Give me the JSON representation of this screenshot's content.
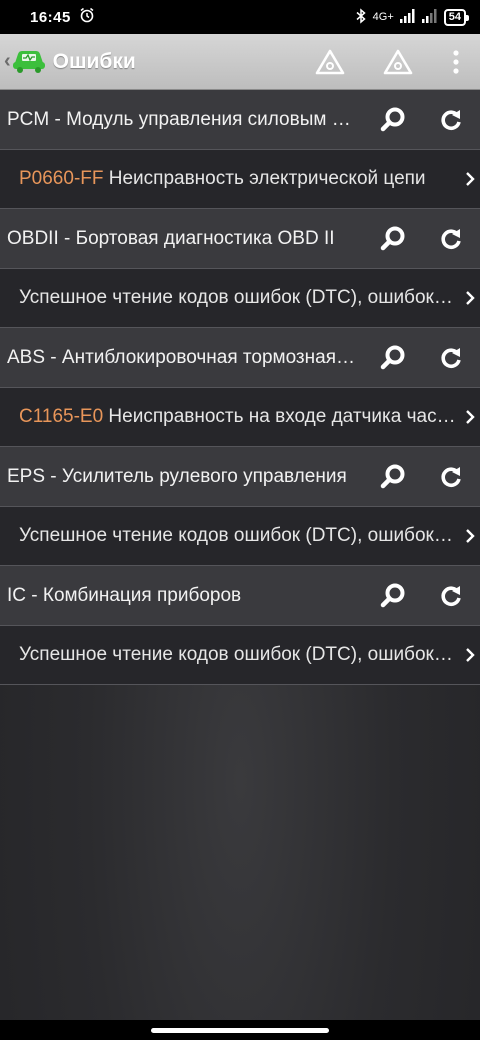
{
  "status_bar": {
    "time": "16:45",
    "network": "4G+",
    "battery": "54",
    "icons": [
      "alarm-icon",
      "bluetooth-icon",
      "signal-icon",
      "wifi-icon",
      "battery-icon"
    ]
  },
  "app_bar": {
    "title": "Ошибки",
    "actions": [
      "warning-triangle-icon",
      "warning-triangle-icon",
      "overflow-menu-icon"
    ]
  },
  "colors": {
    "dtc_code": "#e8965a",
    "module_row_bg": "#3a3a3e",
    "detail_row_bg": "#26262a",
    "app_bar_bg": "#c9c9c9",
    "logo_green": "#3cbf3c"
  },
  "modules": [
    {
      "title": "PCM - Модуль управления силовым агрегатом",
      "result": {
        "code": "P0660-FF",
        "text": " Неисправность электрической цепи"
      }
    },
    {
      "title": "OBDII - Бортовая диагностика OBD II",
      "result": {
        "code": "",
        "text": "Успешное чтение кодов ошибок (DTC), ошибок не обнаружено"
      }
    },
    {
      "title": "ABS - Антиблокировочная тормозная система",
      "result": {
        "code": "C1165-E0",
        "text": " Неисправность на входе датчика частоты"
      }
    },
    {
      "title": "EPS - Усилитель рулевого управления",
      "result": {
        "code": "",
        "text": "Успешное чтение кодов ошибок (DTC), ошибок не обнаружено"
      }
    },
    {
      "title": "IC - Комбинация приборов",
      "result": {
        "code": "",
        "text": "Успешное чтение кодов ошибок (DTC), ошибок не обнаружено"
      }
    }
  ]
}
